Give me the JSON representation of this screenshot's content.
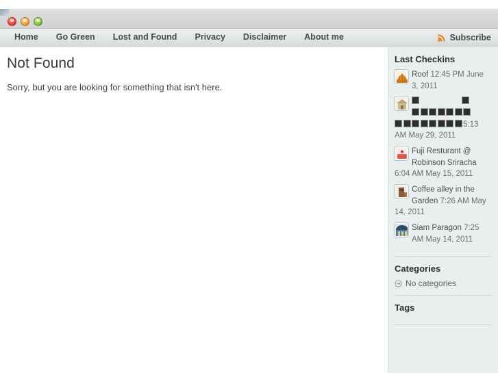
{
  "window": {
    "traffic_lights": [
      {
        "name": "close",
        "color": "#e8493c"
      },
      {
        "name": "minimize",
        "color": "#f0a93c"
      },
      {
        "name": "zoom",
        "color": "#86c63f"
      }
    ]
  },
  "nav": {
    "links": [
      {
        "label": "Home"
      },
      {
        "label": "Go Green"
      },
      {
        "label": "Lost and Found"
      },
      {
        "label": "Privacy"
      },
      {
        "label": "Disclaimer"
      },
      {
        "label": "About me"
      }
    ],
    "subscribe": {
      "label": "Subscribe",
      "icon": "rss-icon",
      "icon_color": "#e8821e"
    }
  },
  "main": {
    "title": "Not Found",
    "body": "Sorry, but you are looking for something that isn't here."
  },
  "sidebar": {
    "widgets": [
      {
        "title": "Last Checkins",
        "type": "checkins",
        "items": [
          {
            "venue": "Roof",
            "date": "12:45 PM June 3, 2011",
            "icon": "roof-venue-icon",
            "icon_color": "#e08a28",
            "unrenderable": false
          },
          {
            "venue": "",
            "date": "5:13 AM May 29, 2011",
            "icon": "hut-venue-icon",
            "icon_color": "#cbbb93",
            "unrenderable": true,
            "tofu_rows": [
              2,
              7,
              8
            ]
          },
          {
            "venue": "Fuji Resturant @ Robinson Sriracha",
            "date": "6:04 AM May 15, 2011",
            "icon": "sushi-venue-icon",
            "icon_color": "#d9584f",
            "unrenderable": false
          },
          {
            "venue": "Coffee alley in the Garden",
            "date": "7:26 AM May 14, 2011",
            "icon": "coffee-venue-icon",
            "icon_color": "#8a5c3a",
            "unrenderable": false
          },
          {
            "venue": "Siam Paragon",
            "date": "7:25 AM May 14, 2011",
            "icon": "mall-venue-icon",
            "icon_color": "#2b4a63",
            "unrenderable": false
          }
        ]
      },
      {
        "title": "Categories",
        "type": "list",
        "items": [
          {
            "label": "No categories",
            "icon": "circle-arrow-icon"
          }
        ]
      },
      {
        "title": "Tags",
        "type": "empty",
        "items": []
      }
    ]
  }
}
